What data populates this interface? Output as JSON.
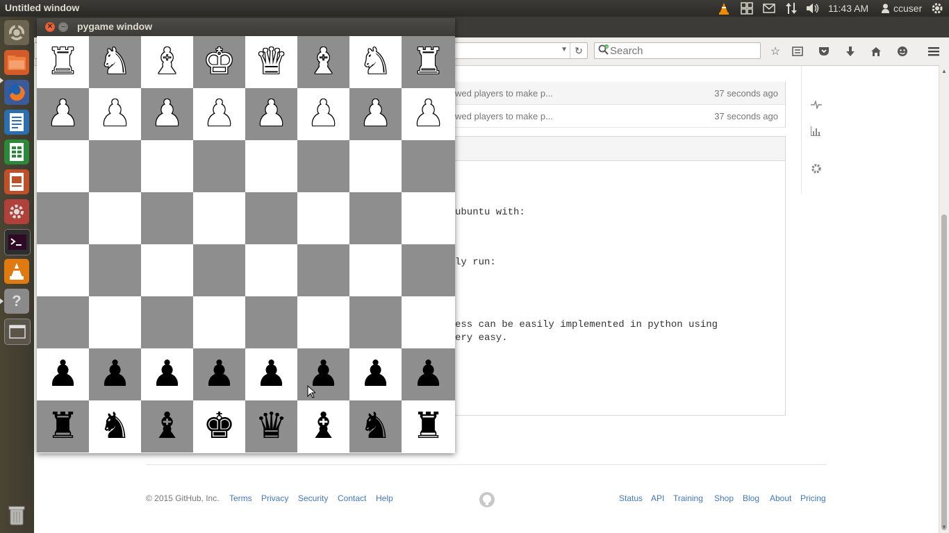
{
  "top_panel": {
    "title": "Untitled window",
    "time": "11:43 AM",
    "user": "ccuser"
  },
  "browser": {
    "search_placeholder": "Search",
    "commits": [
      {
        "message": "wed players to make p...",
        "age": "37 seconds ago"
      },
      {
        "message": "wed players to make p...",
        "age": "37 seconds ago"
      }
    ],
    "readme_lines": [
      {
        "text": "ubuntu with:"
      },
      {
        "text": "ly run:"
      },
      {
        "text": "ess can be easily implemented in python using"
      },
      {
        "text": "ery easy."
      }
    ],
    "footer": {
      "copyright": "© 2015 GitHub, Inc.",
      "left_links": [
        "Terms",
        "Privacy",
        "Security",
        "Contact",
        "Help"
      ],
      "right_links": [
        "Status",
        "API",
        "Training",
        "Shop",
        "Blog",
        "About",
        "Pricing"
      ]
    }
  },
  "pygame": {
    "title": "pygame window",
    "board": [
      [
        "wR",
        "wN",
        "wB",
        "wK",
        "wQ",
        "wB",
        "wN",
        "wR"
      ],
      [
        "wP",
        "wP",
        "wP",
        "wP",
        "wP",
        "wP",
        "wP",
        "wP"
      ],
      [
        "",
        "",
        "",
        "",
        "",
        "",
        "",
        ""
      ],
      [
        "",
        "",
        "",
        "",
        "",
        "",
        "",
        ""
      ],
      [
        "",
        "",
        "",
        "",
        "",
        "",
        "",
        ""
      ],
      [
        "",
        "",
        "",
        "",
        "",
        "",
        "",
        ""
      ],
      [
        "bP",
        "bP",
        "bP",
        "bP",
        "bP",
        "bP",
        "bP",
        "bP"
      ],
      [
        "bR",
        "bN",
        "bB",
        "bK",
        "bQ",
        "bB",
        "bN",
        "bR"
      ]
    ]
  },
  "colors": {
    "light_square": "#ffffff",
    "dark_square": "#8e8e8e",
    "link": "#4078c0"
  }
}
